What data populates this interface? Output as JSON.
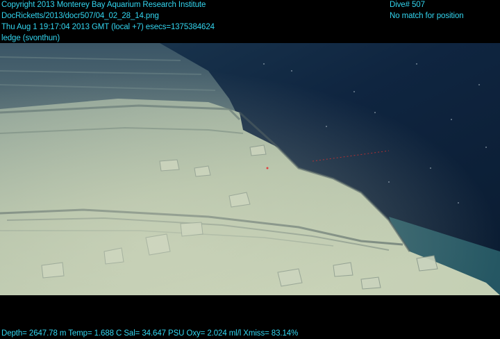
{
  "header": {
    "lines": [
      "Copyright 2013 Monterey Bay Aquarium Research Institute",
      "DocRicketts/2013/docr507/04_02_28_14.png",
      "Thu Aug  1 19:17:04 2013 GMT (local +7)  esecs=1375384624",
      "ledge (svonthun)"
    ],
    "dive": "Dive# 507",
    "position": "No match for position"
  },
  "footer": {
    "telemetry": "Depth= 2647.78 m  Temp= 1.688 C  Sal= 34.647 PSU  Oxy= 2.024 ml/l  Xmiss= 83.14%"
  },
  "colors": {
    "overlay_text": "#33d6f0",
    "water": "#0e2238",
    "sediment": "#b7c4a8",
    "laser": "#d23030"
  }
}
